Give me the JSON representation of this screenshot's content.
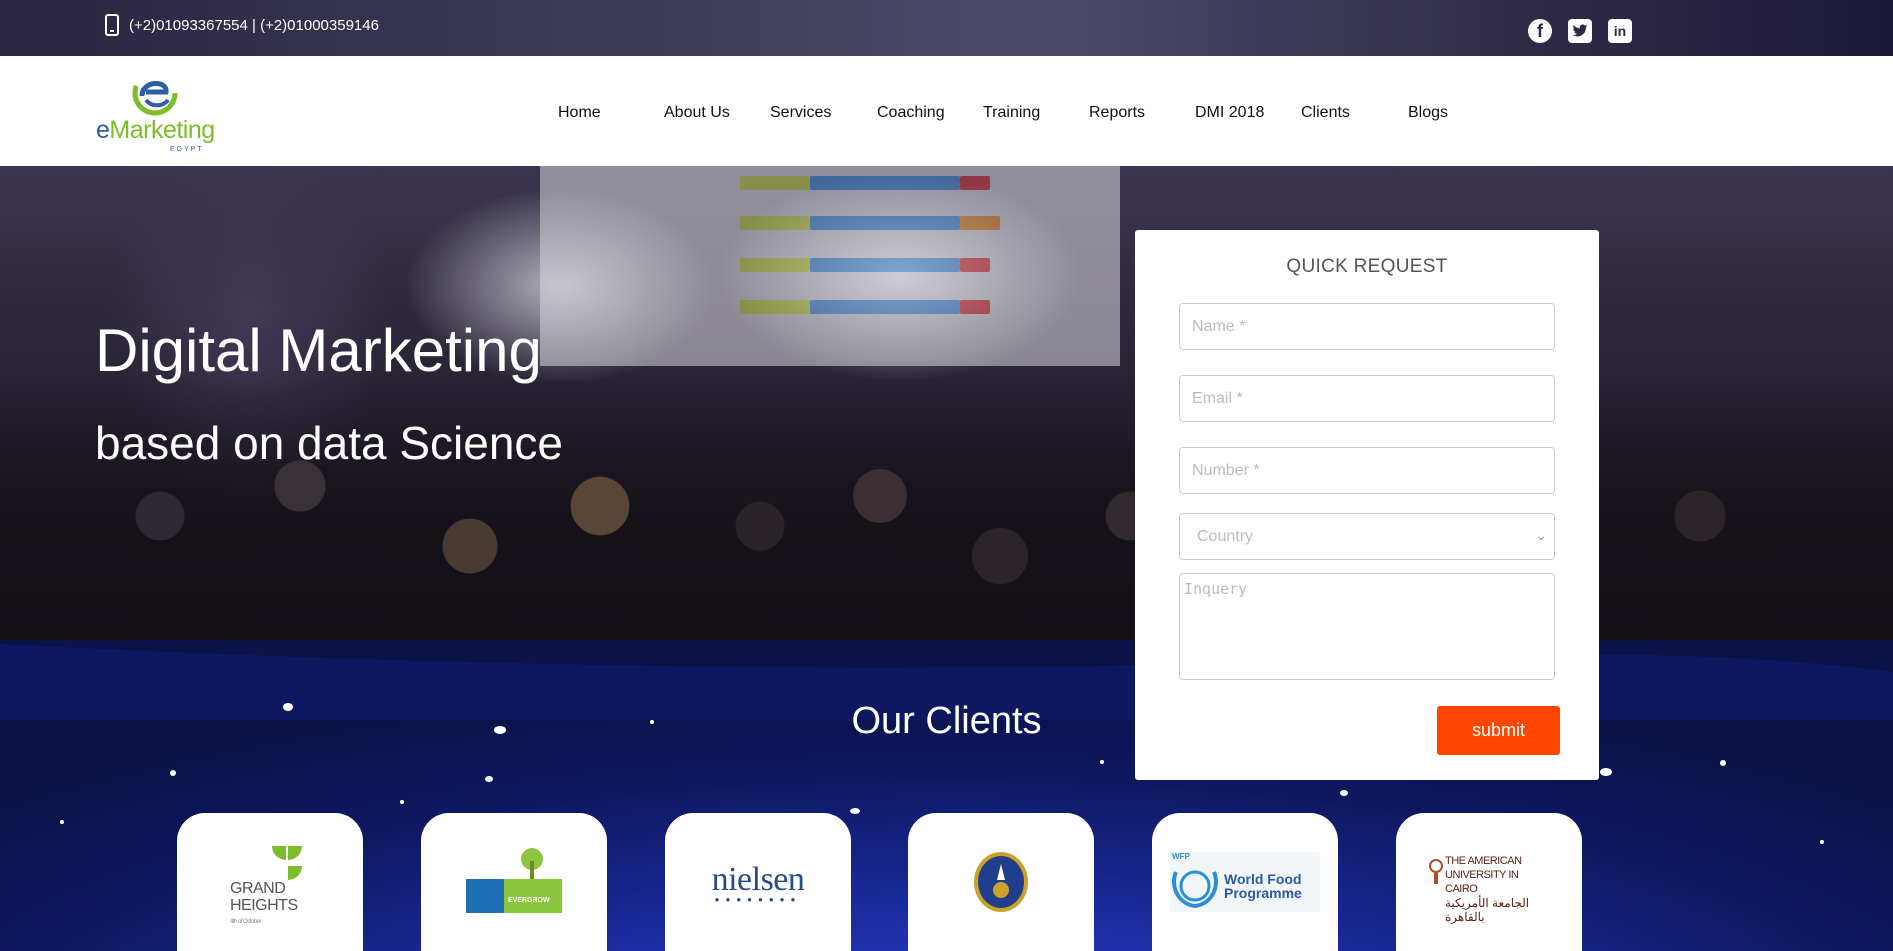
{
  "topbar": {
    "phone_text": "(+2)01093367554 | (+2)01000359146",
    "social": {
      "facebook_glyph": "f",
      "twitter_glyph": "🐦",
      "linkedin_glyph": "in"
    }
  },
  "logo": {
    "word_e": "e",
    "word_rest": "Marketing",
    "sub": "EGYPT"
  },
  "nav": {
    "items": [
      "Home",
      "About Us",
      "Services",
      "Coaching",
      "Training",
      "Reports",
      "DMI 2018",
      "Clients",
      "Blogs"
    ]
  },
  "hero": {
    "title": "Digital Marketing",
    "subtitle": "based on data Science"
  },
  "quick_request": {
    "heading": "QUICK REQUEST",
    "name_placeholder": "Name *",
    "email_placeholder": "Email *",
    "number_placeholder": "Number *",
    "country_selected": "Country",
    "inquiry_placeholder": "Inquery",
    "submit_label": "submit"
  },
  "clients": {
    "title": "Our Clients",
    "logos": [
      {
        "name": "grand-heights",
        "lines": [
          "GRAND",
          "HEIGHTS"
        ],
        "small": "4th of October"
      },
      {
        "name": "evergrow",
        "text": "EVERGROW"
      },
      {
        "name": "nielsen",
        "text": "nielsen"
      },
      {
        "name": "emblem",
        "text": ""
      },
      {
        "name": "wfp",
        "small": "WFP",
        "lines": [
          "World Food",
          "Programme"
        ]
      },
      {
        "name": "auc",
        "lines": [
          "THE AMERICAN",
          "UNIVERSITY IN CAIRO"
        ],
        "arabic": "الجامعة الأمريكية بالقاهرة"
      }
    ]
  },
  "colors": {
    "accent": "#ff4500",
    "logo_green": "#7dbd2a",
    "logo_blue": "#2d5ea8",
    "space_blue": "#1b2b9e"
  }
}
